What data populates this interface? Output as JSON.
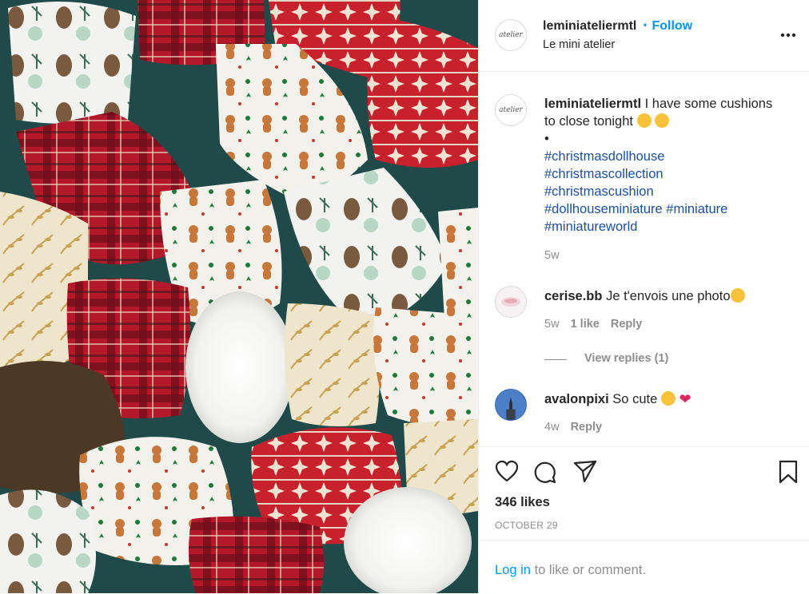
{
  "header": {
    "username": "leminiateliermtl",
    "dot": "•",
    "follow_label": "Follow",
    "location": "Le mini atelier",
    "avatar_text": "atelier"
  },
  "caption": {
    "username": "leminiateliermtl",
    "text": "I have some cushions",
    "text2": "to close tonight",
    "bullet": "•",
    "hashtags": [
      "#christmasdollhouse",
      "#christmascollection",
      "#christmascushion",
      "#dollhouseminiature",
      "#miniature",
      "#miniatureworld"
    ],
    "time": "5w"
  },
  "comments": [
    {
      "username": "cerise.bb",
      "text": "Je t'envois une photo",
      "time": "5w",
      "likes": "1 like",
      "reply": "Reply",
      "view_replies": "View replies (1)"
    },
    {
      "username": "avalonpixi",
      "text": "So cute",
      "time": "4w",
      "reply": "Reply"
    }
  ],
  "actions": {
    "likes": "346 likes",
    "date": "OCTOBER 29"
  },
  "login": {
    "link": "Log in",
    "rest": "to like or comment."
  },
  "colors": {
    "link_blue": "#0095f6",
    "hashtag_blue": "#1e4e9a",
    "muted": "#8e8e8e",
    "photo_bg": "#1f4a49"
  }
}
